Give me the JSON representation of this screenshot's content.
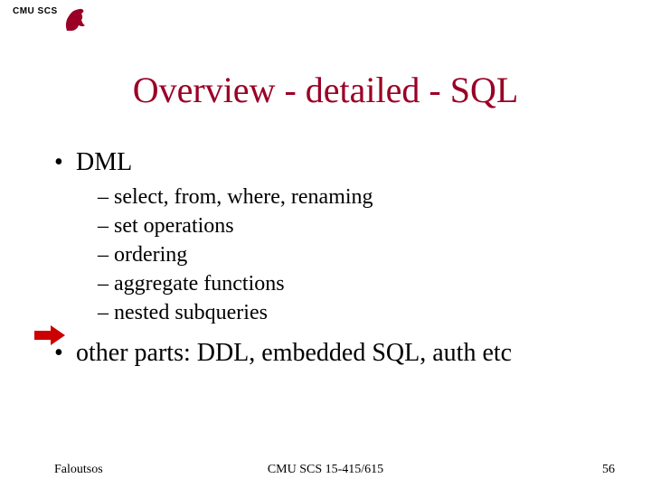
{
  "header": {
    "org": "CMU SCS"
  },
  "title": "Overview - detailed - SQL",
  "bullets": [
    {
      "label": "DML",
      "sub": [
        "select, from, where, renaming",
        "set operations",
        "ordering",
        "aggregate functions",
        "nested subqueries"
      ]
    },
    {
      "label": "other parts: DDL, embedded SQL, auth etc",
      "sub": []
    }
  ],
  "arrow_points_to_index": 4,
  "footer": {
    "author": "Faloutsos",
    "course": "CMU SCS 15-415/615",
    "page": "56"
  },
  "colors": {
    "title": "#9a0026",
    "arrow": "#cc0000"
  }
}
